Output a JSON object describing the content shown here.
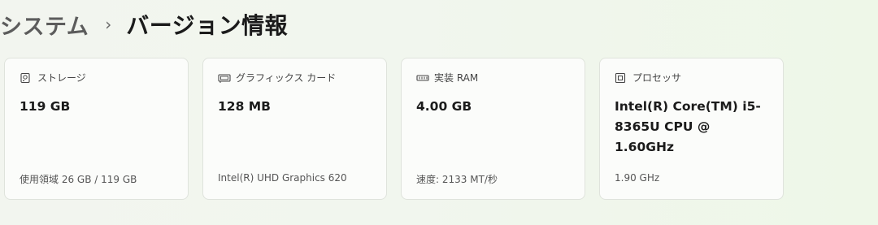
{
  "breadcrumb": {
    "parent": "システム",
    "separator": "›",
    "current": "バージョン情報"
  },
  "cards": [
    {
      "icon": "storage-icon",
      "label": "ストレージ",
      "value": "119 GB",
      "detail": "使用領域 26 GB / 119 GB"
    },
    {
      "icon": "graphics-card-icon",
      "label": "グラフィックス カード",
      "value": "128 MB",
      "detail": "Intel(R) UHD Graphics 620"
    },
    {
      "icon": "ram-icon",
      "label": "実装 RAM",
      "value": "4.00 GB",
      "detail": "速度: 2133 MT/秒"
    },
    {
      "icon": "processor-icon",
      "label": "プロセッサ",
      "value": "Intel(R) Core(TM) i5-8365U CPU @ 1.60GHz",
      "detail": "1.90 GHz"
    }
  ]
}
